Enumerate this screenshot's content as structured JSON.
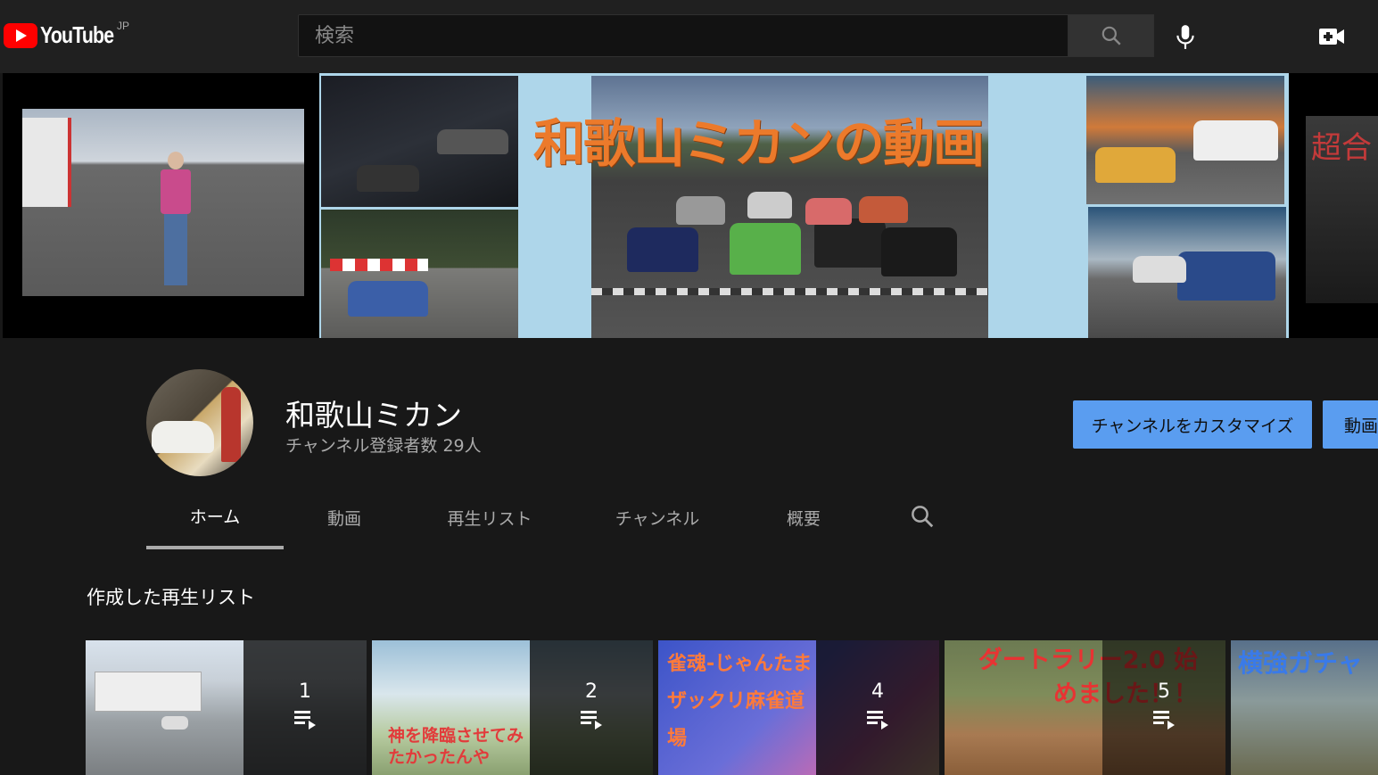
{
  "masthead": {
    "logo_text": "YouTube",
    "country_code": "JP",
    "search_placeholder": "検索",
    "icons": [
      "search-icon",
      "mic-icon",
      "create-video-icon"
    ]
  },
  "banner": {
    "title": "和歌山ミカンの動画",
    "right_text": "超合"
  },
  "channel": {
    "name": "和歌山ミカン",
    "subscribers": "チャンネル登録者数 29人",
    "customize_button": "チャンネルをカスタマイズ",
    "videos_button": "動画"
  },
  "tabs": [
    {
      "label": "ホーム",
      "active": true
    },
    {
      "label": "動画",
      "active": false
    },
    {
      "label": "再生リスト",
      "active": false
    },
    {
      "label": "チャンネル",
      "active": false
    },
    {
      "label": "概要",
      "active": false
    }
  ],
  "section": {
    "title": "作成した再生リスト"
  },
  "playlists": [
    {
      "count": "1",
      "thumb_text": ""
    },
    {
      "count": "2",
      "thumb_text": "神を降臨させてみたかったんや"
    },
    {
      "count": "4",
      "thumb_text": "雀魂-じゃんたま ザックリ麻雀道場"
    },
    {
      "count": "5",
      "thumb_text": "ダートラリー2.0 始めました！！"
    },
    {
      "count": "",
      "thumb_text": "横強ガチャ"
    }
  ],
  "colors": {
    "background": "#181818",
    "masthead": "#202020",
    "accent_button": "#5a9df0",
    "brand_red": "#ff0000",
    "banner_title": "#ec7a2b"
  }
}
